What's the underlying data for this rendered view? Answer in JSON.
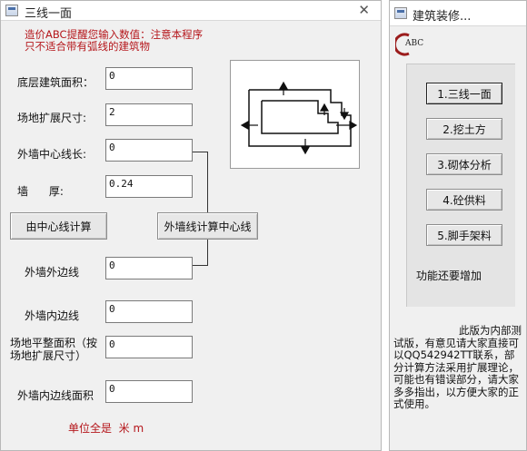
{
  "left_window": {
    "title": "三线一面",
    "close_glyph": "✕",
    "notice": "造价ABC提醒您输入数值：注意本程序只不适合带有弧线的建筑物",
    "fields": [
      {
        "label": "底层建筑面积：",
        "value": "0"
      },
      {
        "label": "场地扩展尺寸:",
        "value": "2"
      },
      {
        "label": "外墙中心线长:",
        "value": "0"
      },
      {
        "label": "墙      厚:",
        "value": "0.24"
      },
      {
        "label": "外墙外边线",
        "value": "0"
      },
      {
        "label": "外墙内边线",
        "value": "0"
      },
      {
        "label": "场地平整面积（按场地扩展尺寸）",
        "value": "0"
      },
      {
        "label": "外墙内边线面积",
        "value": "0"
      }
    ],
    "btn_calc_center": "由中心线计算",
    "btn_calc_outer": "外墙线计算中心线",
    "units": "单位全是  米 m"
  },
  "right_window": {
    "title": "建筑装修...",
    "logo_text": "ABC",
    "menu": [
      {
        "label": "1.三线一面",
        "active": true
      },
      {
        "label": "2.挖土方",
        "active": false
      },
      {
        "label": "3.砌体分析",
        "active": false
      },
      {
        "label": "4.砼供料",
        "active": false
      },
      {
        "label": "5.脚手架料",
        "active": false
      }
    ],
    "more_text": "功能还要增加",
    "note": "此版为内部测试版，有意见请大家直接可以QQ542942TT联系，部分计算方法采用扩展理论，可能也有错误部分，请大家多多指出，以方便大家的正式使用。"
  },
  "colors": {
    "window_bg": "#f0f0f0",
    "notice_red": "#b5161b",
    "button_bg": "#e7e7e7"
  },
  "icons": {
    "app": "window-app-icon",
    "diagram": "building-outline-diagram-icon",
    "close": "close-icon",
    "logo": "abc-logo-icon"
  }
}
